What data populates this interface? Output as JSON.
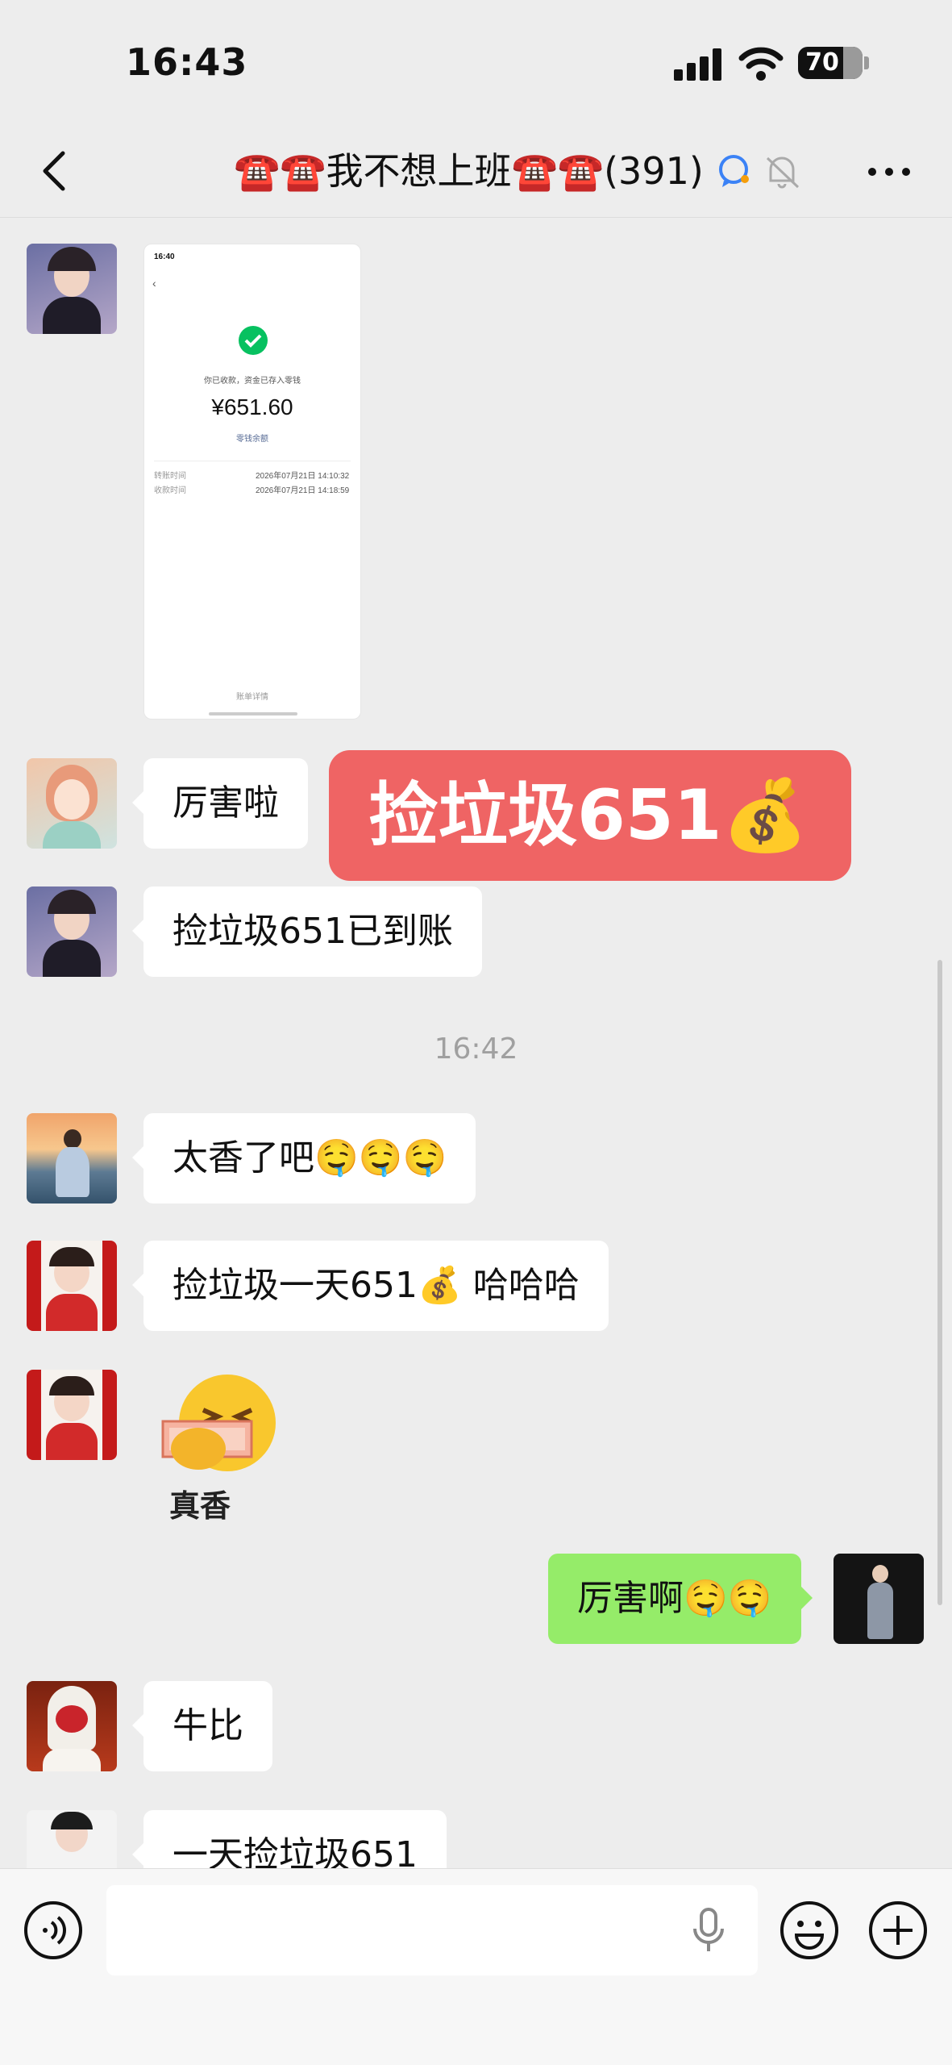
{
  "status_bar": {
    "time": "16:43",
    "battery": "70"
  },
  "header": {
    "title": "☎️☎️我不想上班☎️☎️(391)"
  },
  "payment_screenshot": {
    "time": "16:40",
    "notice": "你已收款，资金已存入零钱",
    "amount": "¥651.60",
    "link": "零钱余额",
    "row1_label": "转账时间",
    "row1_value": "2026年07月21日 14:10:32",
    "row2_label": "收款时间",
    "row2_value": "2026年07月21日 14:18:59",
    "footer": "账单详情"
  },
  "banner": {
    "text": "捡垃圾651💰"
  },
  "messages": [
    {
      "id": "m1",
      "text": "厉害啦"
    },
    {
      "id": "m2",
      "text": "捡垃圾651已到账"
    },
    {
      "id": "m3",
      "text": "太香了吧🤤🤤🤤"
    },
    {
      "id": "m4",
      "text": "捡垃圾一天651💰 哈哈哈"
    },
    {
      "id": "m5",
      "sticker_label": "真香"
    },
    {
      "id": "m6",
      "text": "厉害啊🤤🤤"
    },
    {
      "id": "m7",
      "text": "牛比"
    },
    {
      "id": "m8",
      "text": "一天捡垃圾651"
    }
  ],
  "timestamp": "16:42",
  "colors": {
    "background": "#ededed",
    "my_bubble": "#95ec69",
    "banner": "#ef6464"
  },
  "icons": {
    "back": "chevron-left-icon",
    "more": "more-dots-icon",
    "voice": "voice-icon",
    "emoji": "emoji-icon",
    "plus": "plus-icon",
    "mic": "mic-icon",
    "bell_off": "bell-off-icon",
    "chat_ai": "chat-bubble-icon"
  }
}
